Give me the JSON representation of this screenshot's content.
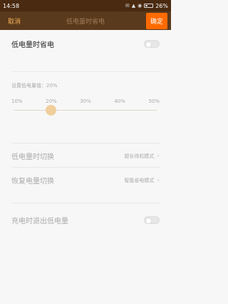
{
  "status": {
    "time": "14:58",
    "battery": "26%"
  },
  "header": {
    "cancel": "取消",
    "title": "低电量时省电",
    "confirm": "确定"
  },
  "main_toggle": {
    "label": "低电量时省电",
    "on": false
  },
  "threshold": {
    "caption": "设置低电量值：20%",
    "ticks": [
      "10%",
      "20%",
      "30%",
      "40%",
      "50%"
    ],
    "value_percent": 20
  },
  "switch_row": {
    "label": "低电量时切换",
    "value": "超长待机模式"
  },
  "restore_row": {
    "label": "恢复电量切换",
    "value": "智能省电模式"
  },
  "charge_row": {
    "label": "充电时退出低电量",
    "on": false
  }
}
